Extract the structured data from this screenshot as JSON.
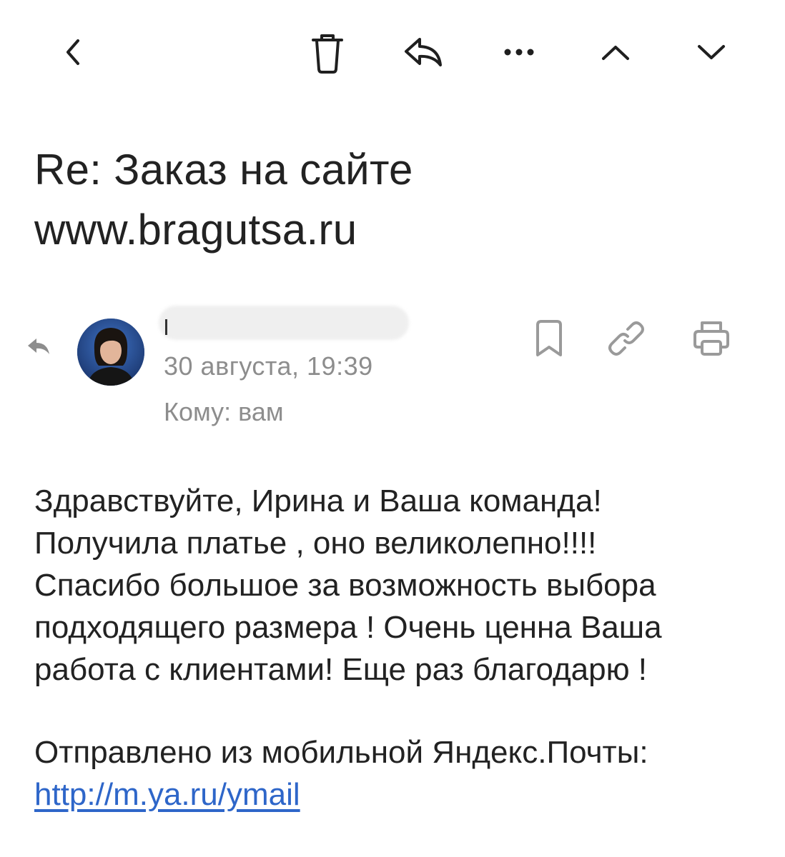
{
  "toolbar": {
    "back_icon": "chevron-left-icon",
    "delete_icon": "trash-icon",
    "reply_icon": "reply-icon",
    "more_icon": "more-horizontal-icon",
    "prev_icon": "chevron-up-icon",
    "next_icon": "chevron-down-icon"
  },
  "message": {
    "subject_line1": "Re: Заказ на сайте",
    "subject_line2": "www.bragutsa.ru",
    "date": "30 августа, 19:39",
    "recipient": "Кому: вам",
    "body_lines": [
      "Здравствуйте, Ирина и Ваша команда!",
      "Получила платье , оно великолепно!!!!",
      "Спасибо большое за возможность выбора",
      "подходящего размера ! Очень ценна Ваша",
      "работа с клиентами! Еще раз благодарю !"
    ],
    "signature_text": "Отправлено из мобильной Яндекс.Почты:",
    "signature_link": "http://m.ya.ru/ymail"
  },
  "actions": {
    "bookmark_icon": "bookmark-icon",
    "link_icon": "link-icon",
    "print_icon": "printer-icon"
  },
  "colors": {
    "text": "#222222",
    "muted": "#8d8d8d",
    "link": "#2e66c9",
    "icon": "#1f1f1f",
    "icon_muted": "#9a9a9a"
  }
}
